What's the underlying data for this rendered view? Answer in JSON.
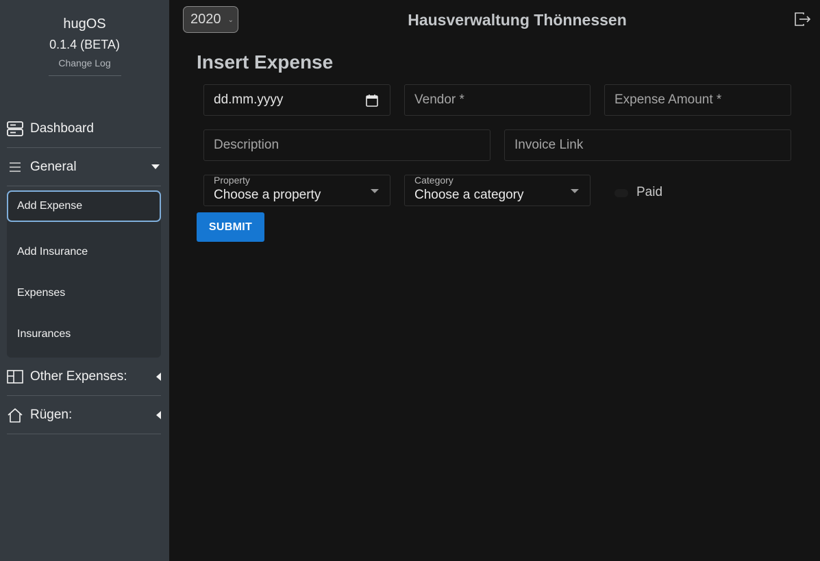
{
  "brand": {
    "name": "hugOS",
    "version": "0.1.4 (BETA)",
    "changelog": "Change Log"
  },
  "sidebar": {
    "dashboard": {
      "label": "Dashboard",
      "icon": "dashboard-server-icon"
    },
    "general": {
      "label": "General",
      "icon": "hamburger-icon",
      "expanded": true,
      "items": [
        {
          "label": "Add Expense",
          "active": true
        },
        {
          "label": "Add Insurance"
        },
        {
          "label": "Expenses"
        },
        {
          "label": "Insurances"
        }
      ]
    },
    "other_expenses": {
      "label": "Other Expenses:",
      "icon": "layout-panels-icon"
    },
    "ruegen": {
      "label": "Rügen:",
      "icon": "house-icon"
    }
  },
  "header": {
    "year": "2020",
    "title": "Hausverwaltung Thönnessen",
    "logout_icon": "logout-icon"
  },
  "form": {
    "heading": "Insert Expense",
    "date_placeholder": "dd.mm.yyyy",
    "vendor_placeholder": "Vendor *",
    "amount_placeholder": "Expense Amount *",
    "description_placeholder": "Description",
    "invoice_placeholder": "Invoice Link",
    "property": {
      "label": "Property",
      "value": "Choose a property"
    },
    "category": {
      "label": "Category",
      "value": "Choose a category"
    },
    "paid_label": "Paid",
    "paid": false,
    "submit_label": "SUBMIT"
  },
  "colors": {
    "sidebar_bg": "#343a40",
    "main_bg": "#141414",
    "primary": "#1677d2",
    "active_border": "#7faedb"
  }
}
